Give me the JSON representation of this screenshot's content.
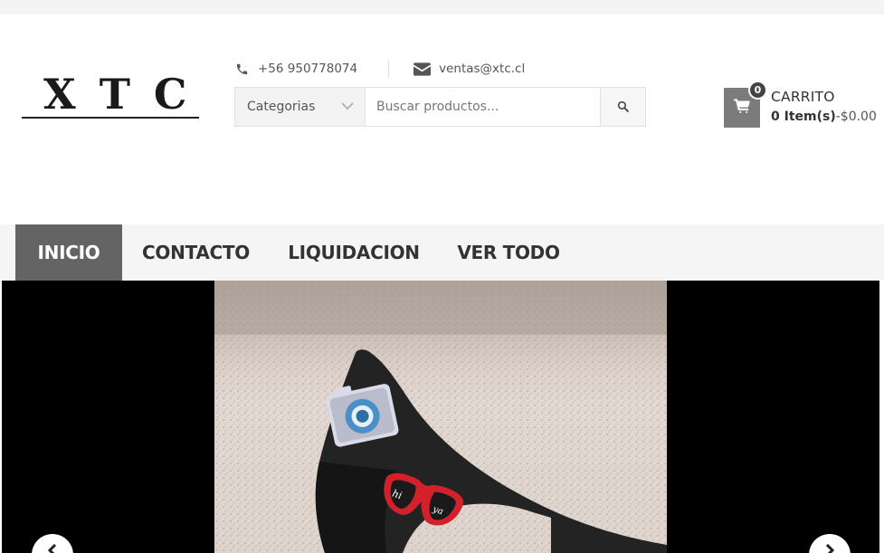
{
  "brand": {
    "logo_text": "XTC"
  },
  "contact": {
    "phone": "+56 950778074",
    "email": "ventas@xtc.cl"
  },
  "search": {
    "category_label": "Categorias",
    "placeholder": "Buscar productos..."
  },
  "cart": {
    "count": "0",
    "title": "CARRITO",
    "items_label": "0 Item(s)",
    "separator": "-",
    "total": "$0.00"
  },
  "nav": {
    "items": [
      {
        "label": "INICIO",
        "active": true
      },
      {
        "label": "CONTACTO",
        "active": false
      },
      {
        "label": "LIQUIDACION",
        "active": false
      },
      {
        "label": "VER TODO",
        "active": false
      }
    ]
  },
  "slider": {
    "image": "black denim high-heel shoe with camera and sunglasses patches",
    "prev_icon": "chevron-left-icon",
    "next_icon": "chevron-right-icon"
  },
  "icons": {
    "phone": "phone-icon",
    "email": "envelope-icon",
    "search": "search-icon",
    "cart": "shopping-cart-icon",
    "dropdown": "chevron-down-icon"
  },
  "colors": {
    "nav_active_bg": "#646464",
    "cart_box_bg": "#7b7b7b",
    "cart_badge_bg": "#444444"
  }
}
